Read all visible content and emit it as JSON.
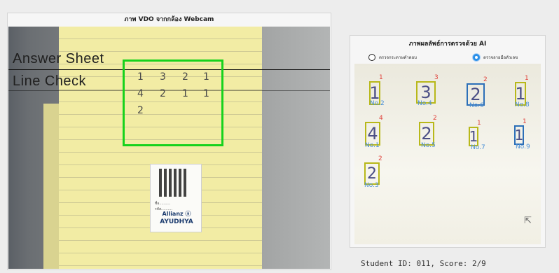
{
  "webcam_panel": {
    "title": "ภาพ VDO จากกล้อง Webcam",
    "overlay_title": "Answer Sheet",
    "overlay_subtitle": "Line Check",
    "answer_rows": [
      [
        "1",
        "3",
        "2",
        "1"
      ],
      [
        "4",
        "2",
        "1",
        "1"
      ],
      [
        "2"
      ]
    ],
    "qr_card_lines": [
      "ชื่อ..........",
      "รหัส.........."
    ],
    "brand_name": "Allianz ⓐ",
    "brand_sub": "AYUDHYA"
  },
  "ai_panel": {
    "title": "ภาพผลลัพธ์การตรวจด้วย AI",
    "radio_options": [
      {
        "label": "ตรวจกระดาษคำตอบ",
        "selected": false
      },
      {
        "label": "ตรวจลายมือตัวเลข",
        "selected": true
      }
    ],
    "detections": [
      {
        "digit": "1",
        "score": "1",
        "label": "No.2",
        "box_color": "#b8b81a"
      },
      {
        "digit": "3",
        "score": "3",
        "label": "No.4",
        "box_color": "#b8b81a"
      },
      {
        "digit": "2",
        "score": "2",
        "label": "No.6",
        "box_color": "#2c6fb8"
      },
      {
        "digit": "1",
        "score": "1",
        "label": "No.8",
        "box_color": "#b8b81a"
      },
      {
        "digit": "4",
        "score": "4",
        "label": "No.1",
        "box_color": "#b8b81a"
      },
      {
        "digit": "2",
        "score": "2",
        "label": "No.5",
        "box_color": "#b8b81a"
      },
      {
        "digit": "1",
        "score": "1",
        "label": "No.7",
        "box_color": "#b8b81a"
      },
      {
        "digit": "1",
        "score": "1",
        "label": "No.9",
        "box_color": "#2c6fb8"
      },
      {
        "digit": "2",
        "score": "2",
        "label": "No.3",
        "box_color": "#b8b81a"
      }
    ],
    "student_line": "Student ID: 011, Score: 2/9",
    "cursor_icon": "pointer-arrow-icon"
  }
}
